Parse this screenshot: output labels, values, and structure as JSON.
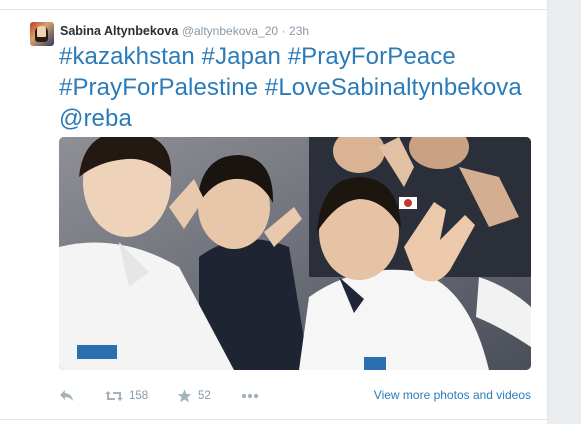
{
  "tweet": {
    "author_name": "Sabina Altynbekova",
    "author_handle": "@altynbekova_20",
    "separator": "·",
    "timestamp": "23h",
    "text_lines": [
      "#kazakhstan #Japan #PrayForPeace",
      "#PrayForPalestine #LoveSabinaltynbekova",
      "@reba"
    ]
  },
  "actions": {
    "reply_icon": "reply-icon",
    "retweet_icon": "retweet-icon",
    "retweet_count": "158",
    "favorite_icon": "star-icon",
    "favorite_count": "52",
    "more_icon": "more-dots-icon",
    "media_link": "View more photos and videos"
  },
  "colors": {
    "link": "#2b7bb9",
    "text": "#292f33",
    "muted": "#8899a6",
    "background": "#e9edf0"
  }
}
